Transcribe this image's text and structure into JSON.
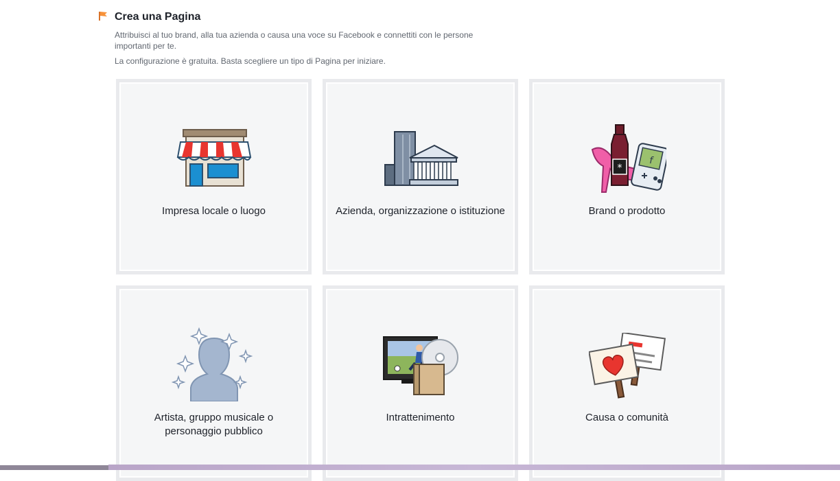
{
  "header": {
    "title": "Crea una Pagina",
    "description": "Attribuisci al tuo brand, alla tua azienda o causa una voce su Facebook e connettiti con le persone importanti per te.",
    "setup": "La configurazione è gratuita. Basta scegliere un tipo di Pagina per iniziare."
  },
  "cards": [
    {
      "label": "Impresa locale o luogo",
      "icon": "storefront-icon"
    },
    {
      "label": "Azienda, organizzazione o istituzione",
      "icon": "office-buildings-icon"
    },
    {
      "label": "Brand o prodotto",
      "icon": "brand-products-icon"
    },
    {
      "label": "Artista, gruppo musicale o personaggio pubblico",
      "icon": "public-figure-icon"
    },
    {
      "label": "Intrattenimento",
      "icon": "entertainment-icon"
    },
    {
      "label": "Causa o comunità",
      "icon": "cause-signs-icon"
    }
  ],
  "colors": {
    "title_icon": "#f7923a",
    "card_bg": "#f5f6f7",
    "card_border": "#e9eaed",
    "text": "#1d2129",
    "muted": "#616770"
  }
}
